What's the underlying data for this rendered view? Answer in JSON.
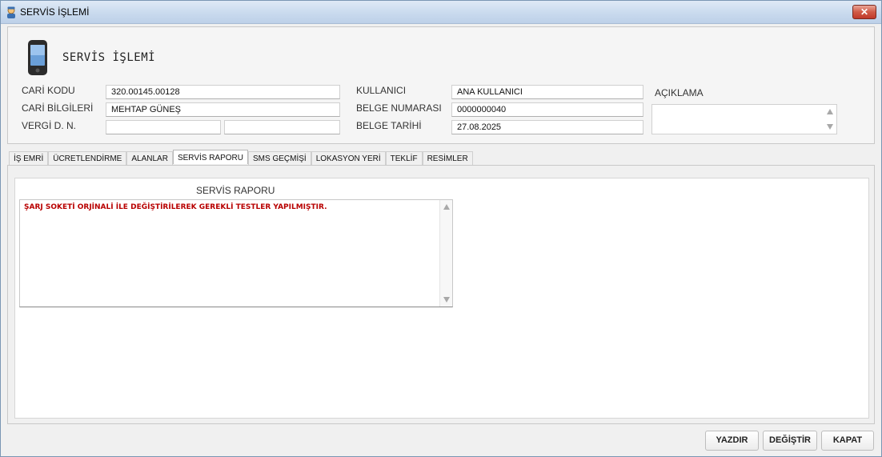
{
  "window": {
    "title": "SERVİS İŞLEMİ",
    "close_label": "✕"
  },
  "header": {
    "form_title": "SERVİS İŞLEMİ",
    "cari_kodu_label": "CARİ KODU",
    "cari_kodu_value": "320.00145.00128",
    "cari_bilgileri_label": "CARİ BİLGİLERİ",
    "cari_bilgileri_value": "MEHTAP GÜNEŞ",
    "vergi_label": "VERGİ D. N.",
    "vergi_dairesi_value": "",
    "vergi_no_value": "",
    "kullanici_label": "KULLANICI",
    "kullanici_value": "ANA KULLANICI",
    "belge_numarasi_label": "BELGE NUMARASI",
    "belge_numarasi_value": "0000000040",
    "belge_tarihi_label": "BELGE TARİHİ",
    "belge_tarihi_value": "27.08.2025",
    "aciklama_label": "AÇIKLAMA",
    "aciklama_value": ""
  },
  "tabs": [
    {
      "label": "İŞ EMRİ",
      "active": false
    },
    {
      "label": "ÜCRETLENDİRME",
      "active": false
    },
    {
      "label": "ALANLAR",
      "active": false
    },
    {
      "label": "SERVİS RAPORU",
      "active": true
    },
    {
      "label": "SMS GEÇMİŞİ",
      "active": false
    },
    {
      "label": "LOKASYON YERİ",
      "active": false
    },
    {
      "label": "TEKLİF",
      "active": false
    },
    {
      "label": "RESİMLER",
      "active": false
    }
  ],
  "servis_raporu": {
    "label": "SERVİS RAPORU",
    "text": "ŞARJ SOKETİ ORJİNALİ İLE DEĞİŞTİRİLEREK GEREKLİ TESTLER YAPILMIŞTIR."
  },
  "buttons": {
    "yazdir": "YAZDIR",
    "degistir": "DEĞİŞTİR",
    "kapat": "KAPAT"
  },
  "colors": {
    "report_text": "#b80000",
    "titlebar": "#c9daee",
    "close_button": "#c0392b"
  }
}
